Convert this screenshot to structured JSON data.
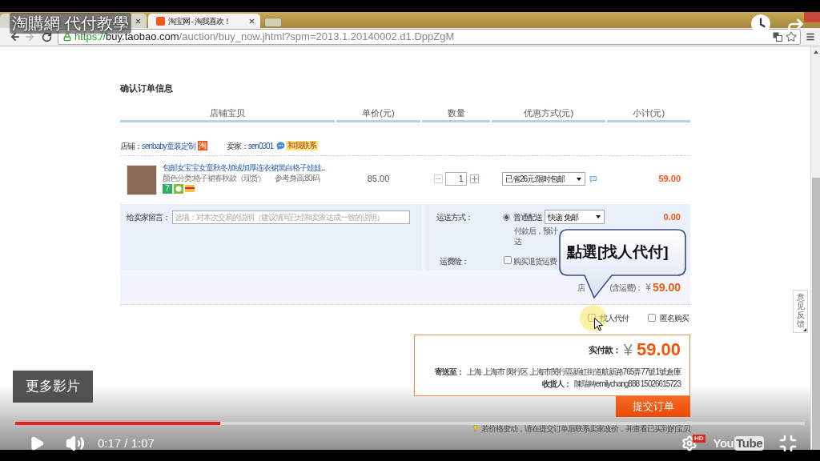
{
  "player": {
    "title": "淘購網 代付教學",
    "more_videos": "更多影片",
    "progress": {
      "level": 0.26
    },
    "playing": false,
    "time": "0:17 / 1:07",
    "hd": "HD",
    "logo_left": "You",
    "logo_right": "Tube"
  },
  "browser": {
    "tabs": [
      {
        "selected": false
      },
      {
        "label": "淘宝网 - 淘我喜欢！",
        "selected": true
      }
    ],
    "forward_disabled": true,
    "url": {
      "scheme": "https://",
      "host": "buy.taobao.com",
      "path": "/auction/buy_now.jhtml?spm=2013.1.20140002.d1.DppZgM"
    }
  },
  "order": {
    "title": "确认订单信息",
    "columns": [
      "店铺宝贝",
      "单价(元)",
      "数量",
      "优惠方式(元)",
      "小计(元)"
    ],
    "shop": {
      "label": "店铺：",
      "name": "senbaby童装定制",
      "badge": "淘",
      "seller_label": "卖家：",
      "seller": "sen0301",
      "contact": "和我联系"
    },
    "item": {
      "title": "包邮女宝宝女童秋冬加绒加厚连衣裙黑白格子娃娃...",
      "variant": "颜色分类:格子裙春秋款（现货）",
      "size": "参考身高:80码",
      "badge": "7",
      "price": "85.00",
      "quantity": "1",
      "promotion": "已省26元:限时包邮",
      "subtotal": "59.00"
    },
    "message": {
      "label": "给卖家留言：",
      "placeholder": "选填：对本次交易的说明（建议填写已经和卖家达成一致的说明）"
    },
    "shipping": {
      "label": "运送方式：",
      "option": "普通配送",
      "selected": true,
      "method": "快递 免邮",
      "cost": "0.00",
      "estimate": [
        "付款后，预计",
        "达"
      ]
    },
    "insurance": {
      "label": "运费险：",
      "option": "购买退货运费",
      "checked": false
    },
    "shop_total": {
      "label_start": "店",
      "label_end": "(含运费)：",
      "currency": "¥",
      "amount": "59.00"
    },
    "options": [
      {
        "label": "找人代付",
        "checked": false
      },
      {
        "label": "匿名购买",
        "checked": false
      }
    ],
    "summary": {
      "paid_label": "实付款：",
      "currency": "¥",
      "amount": "59.00",
      "address_label": "寄送至：",
      "address": "上海 上海市 闵行区 上海市閔行區新虹街道航新路765弄77號1號倉庫",
      "receiver_label": "收货人：",
      "receiver": "陳瑞轉emilychang888 15026615723"
    },
    "submit": "提交订单",
    "notice": "若价格变动，请在提交订单后联系卖家改价，并查看已买到的宝贝"
  },
  "callout": "點選[找人代付]",
  "feedback": "意见反馈"
}
